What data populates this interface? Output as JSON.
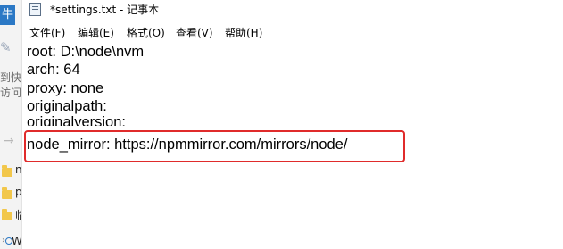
{
  "background_explorer": {
    "tab_glyph": "牛",
    "quick_access_lines": [
      "到快",
      "访问"
    ],
    "folders": [
      "n",
      "p",
      "临"
    ],
    "network_label": "WF"
  },
  "notepad": {
    "title": "*settings.txt - 记事本",
    "menu": [
      {
        "label": "文件(F)"
      },
      {
        "label": "编辑(E)"
      },
      {
        "label": "格式(O)"
      },
      {
        "label": "查看(V)"
      },
      {
        "label": "帮助(H)"
      }
    ],
    "lines": [
      "root: D:\\node\\nvm",
      "arch: 64",
      "proxy: none",
      "originalpath:",
      "originalversion:",
      "node_mirror: https://npmmirror.com/mirrors/node/"
    ]
  },
  "colors": {
    "highlight_border": "#e02b2b",
    "explorer_tab": "#2b78c5",
    "folder": "#f2c74b"
  }
}
